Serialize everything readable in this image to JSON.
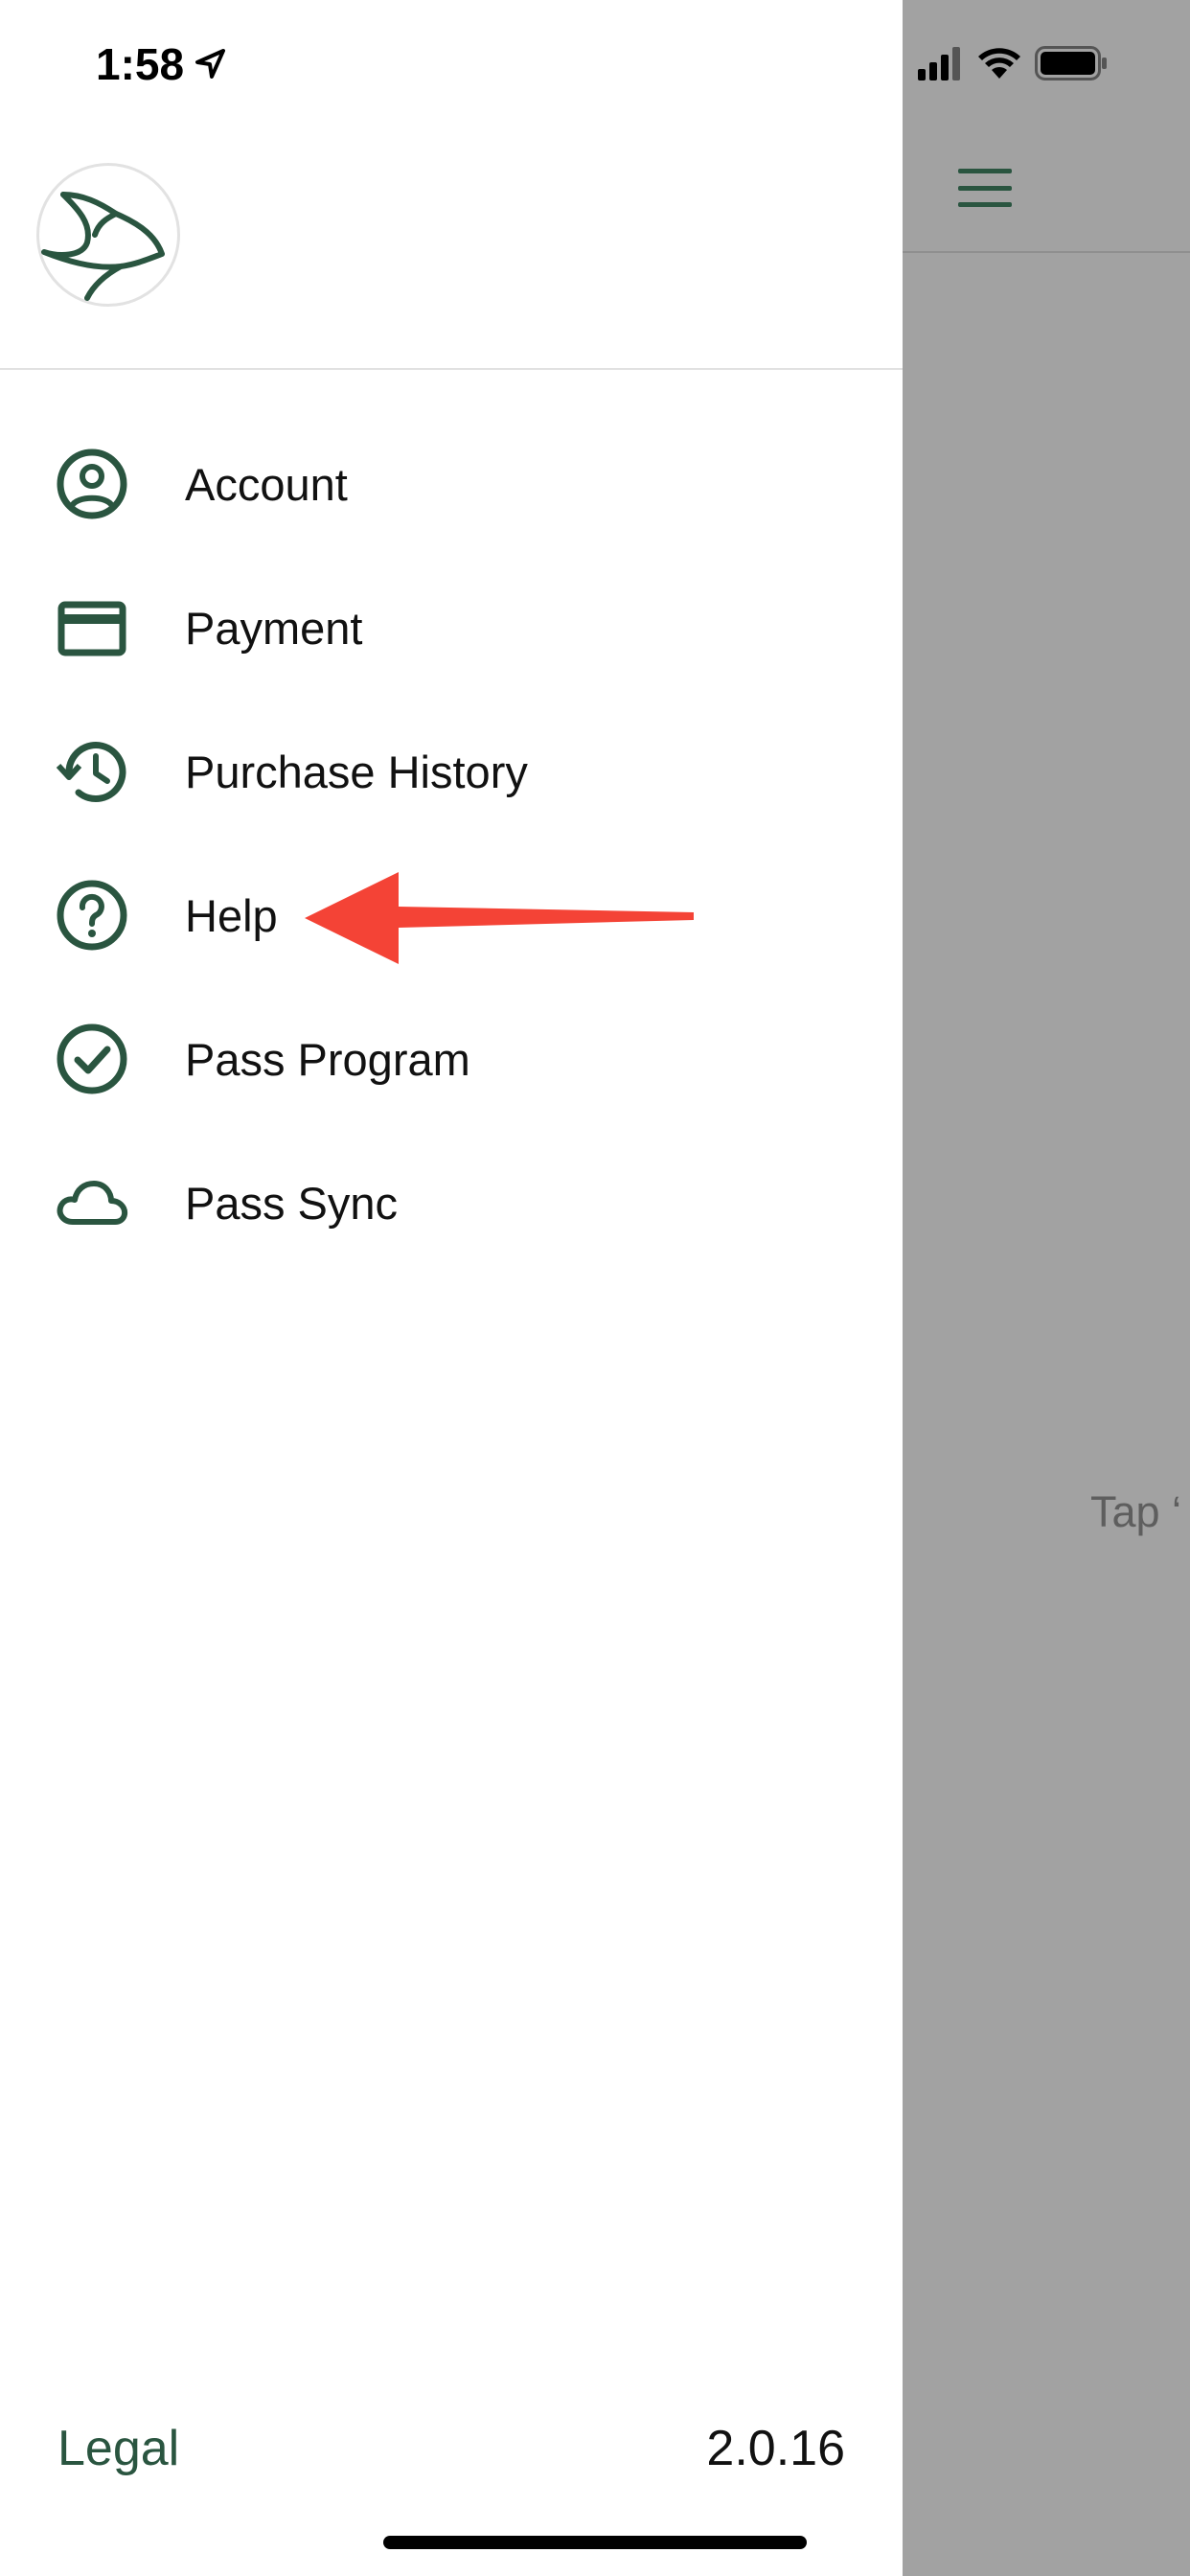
{
  "status_bar": {
    "time": "1:58"
  },
  "drawer": {
    "menu_items": [
      {
        "label": "Account",
        "icon": "account-circle-icon"
      },
      {
        "label": "Payment",
        "icon": "credit-card-icon"
      },
      {
        "label": "Purchase History",
        "icon": "history-icon"
      },
      {
        "label": "Help",
        "icon": "help-circle-icon"
      },
      {
        "label": "Pass Program",
        "icon": "check-circle-icon"
      },
      {
        "label": "Pass Sync",
        "icon": "cloud-icon"
      }
    ],
    "footer": {
      "legal_label": "Legal",
      "version": "2.0.16"
    }
  },
  "background_screen": {
    "hint_text": "Tap ‘"
  },
  "colors": {
    "accent": "#2a5540",
    "arrow": "#f44336",
    "backdrop": "#a2a2a2"
  }
}
